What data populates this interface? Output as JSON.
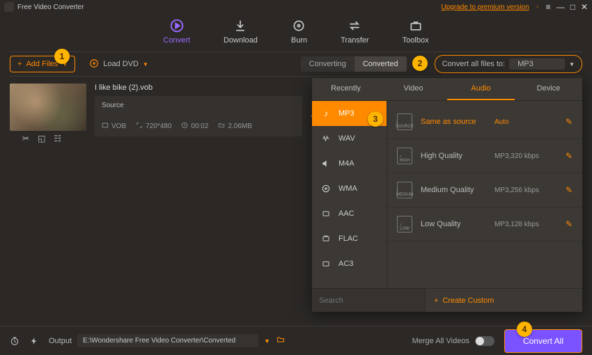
{
  "app": {
    "title": "Free Video Converter",
    "upgrade": "Upgrade to premium version"
  },
  "nav": {
    "convert": "Convert",
    "download": "Download",
    "burn": "Burn",
    "transfer": "Transfer",
    "toolbox": "Toolbox"
  },
  "toolbar": {
    "add_files": "Add Files",
    "load_dvd": "Load DVD",
    "tab_converting": "Converting",
    "tab_converted": "Converted",
    "convert_all_label": "Convert all files to:",
    "convert_all_value": "MP3"
  },
  "file": {
    "name": "I like bike (2).vob",
    "source_label": "Source",
    "codec": "VOB",
    "resolution": "720*480",
    "duration": "00:02",
    "size": "2.06MB"
  },
  "dropdown": {
    "tabs": {
      "recently": "Recently",
      "video": "Video",
      "audio": "Audio",
      "device": "Device"
    },
    "formats": [
      "MP3",
      "WAV",
      "M4A",
      "WMA",
      "AAC",
      "FLAC",
      "AC3"
    ],
    "qualities": [
      {
        "name": "Same as source",
        "detail": "Auto",
        "highlight": true,
        "badge": "SOURCE"
      },
      {
        "name": "High Quality",
        "detail": "MP3,320 kbps",
        "highlight": false,
        "badge": "HIGH"
      },
      {
        "name": "Medium Quality",
        "detail": "MP3,256 kbps",
        "highlight": false,
        "badge": "MEDIUM"
      },
      {
        "name": "Low Quality",
        "detail": "MP3,128 kbps",
        "highlight": false,
        "badge": "LOW"
      }
    ],
    "search_placeholder": "Search",
    "create_custom": "Create Custom"
  },
  "bottom": {
    "output_label": "Output",
    "output_path": "E:\\Wondershare Free Video Converter\\Converted",
    "merge_label": "Merge All Videos",
    "convert_all": "Convert All"
  },
  "callouts": {
    "c1": "1",
    "c2": "2",
    "c3": "3",
    "c4": "4"
  }
}
